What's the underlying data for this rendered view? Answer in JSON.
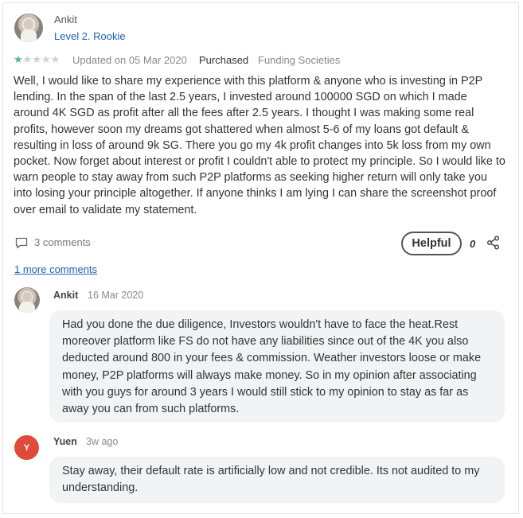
{
  "review": {
    "author": "Ankit",
    "level": "Level 2. Rookie",
    "rating": 1,
    "rating_max": 5,
    "updated": "Updated on 05 Mar 2020",
    "purchased": "Purchased",
    "company": "Funding Societies",
    "text": "Well, I would like to share my experience with this platform & anyone who is investing in P2P lending. In the span of the last 2.5 years, I invested around 100000 SGD on which I made around 4K SGD as profit after all the fees after 2.5 years. I thought I was making some real profits, however soon my dreams got shattered when almost 5-6 of my loans got default & resulting in loss of around 9k SG. There you go my 4k profit changes into 5k loss from my own pocket. Now forget about interest or profit I couldn't able to protect my principle. So I would like to warn people to stay away from such P2P platforms as seeking higher return will only take you into losing your principle altogether. If anyone thinks I am lying I can share the screenshot proof over email to validate my statement.",
    "comments_label": "3 comments",
    "helpful_label": "Helpful",
    "helpful_count": "0",
    "more_comments": "1 more comments"
  },
  "comments": [
    {
      "name": "Ankit",
      "date": "16 Mar 2020",
      "text": "Had you done the due diligence, Investors wouldn't have to face the heat.Rest moreover platform like FS do not have any liabilities since out of the 4K you also deducted around 800 in your fees & commission. Weather investors loose or make money, P2P platforms will always make money. So in my opinion after associating with you guys for around 3 years I would still stick to my opinion to stay as far as away you can from such platforms."
    },
    {
      "name": "Yuen",
      "initial": "Y",
      "date": "3w ago",
      "text": "Stay away, their default rate is artificially low and not credible. Its not audited to my understanding."
    }
  ],
  "icons": {
    "comment": "comment-icon",
    "share": "share-icon",
    "star": "star-icon"
  },
  "colors": {
    "star_filled": "#4fbf7c",
    "link": "#2060b8",
    "avatar_y": "#e04a3a"
  }
}
